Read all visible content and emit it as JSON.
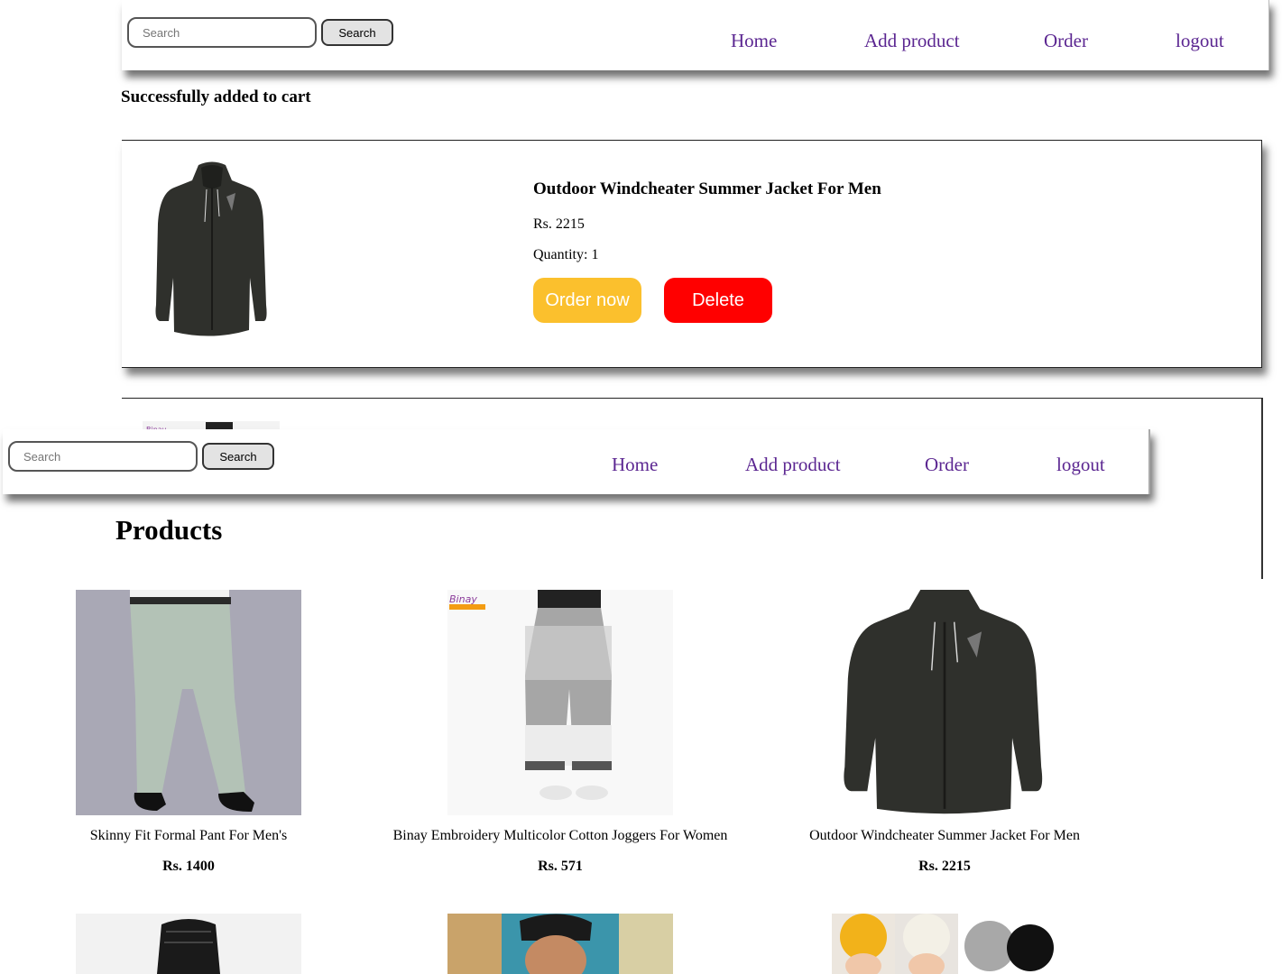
{
  "navbar": {
    "search_placeholder": "Search",
    "search_button": "Search",
    "links": [
      "Home",
      "Add product",
      "Order",
      "logout"
    ]
  },
  "flash_message": "Successfully added to cart",
  "cart": {
    "items": [
      {
        "title": "Outdoor Windcheater Summer Jacket For Men",
        "price": "Rs. 2215",
        "quantity": "Quantity: 1",
        "image_icon": "jacket-image"
      }
    ],
    "order_button": "Order now",
    "delete_button": "Delete",
    "colors": {
      "order": "#fbc02d",
      "delete": "#ff0000"
    }
  },
  "products": {
    "title": "Products",
    "items": [
      {
        "name": "Skinny Fit Formal Pant For Men's",
        "price": "Rs. 1400",
        "image_icon": "pant-image"
      },
      {
        "name": "Binay Embroidery Multicolor Cotton Joggers For Women",
        "price": "Rs. 571",
        "image_icon": "joggers-image"
      },
      {
        "name": "Outdoor Windcheater Summer Jacket For Men",
        "price": "Rs. 2215",
        "image_icon": "jacket-image"
      },
      {
        "name": "",
        "price": "",
        "image_icon": "vest-image"
      },
      {
        "name": "",
        "price": "",
        "image_icon": "man-portrait-image"
      },
      {
        "name": "",
        "price": "",
        "image_icon": "baby-turban-image"
      }
    ]
  },
  "colors": {
    "nav_link": "#5b2691"
  }
}
